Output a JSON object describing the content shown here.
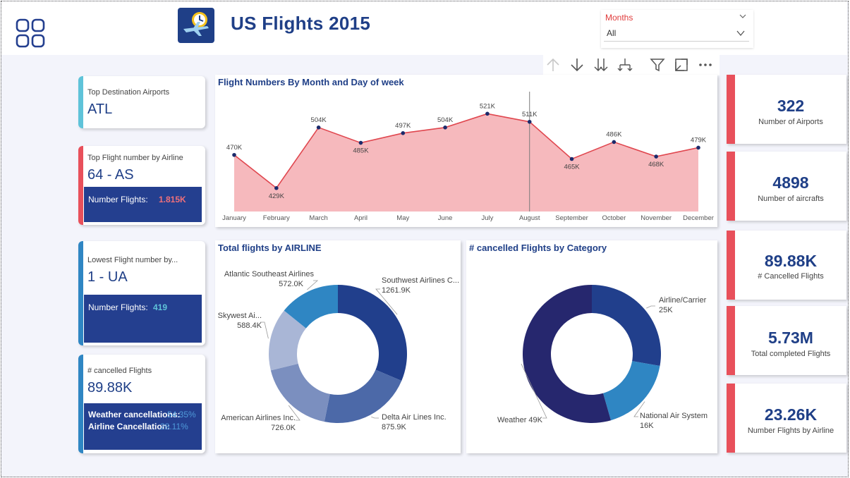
{
  "header": {
    "title": "US Flights 2015",
    "slicer": {
      "label": "Months",
      "value": "All"
    }
  },
  "toolbar": {
    "buttons": [
      "arrow-up-icon",
      "arrow-down-icon",
      "double-arrow-down-icon",
      "expand-hierarchy-icon",
      "filter-icon",
      "focus-mode-icon",
      "more-options-icon"
    ]
  },
  "cards": {
    "top_destination": {
      "label": "Top Destination Airports",
      "value": "ATL"
    },
    "top_airline": {
      "label": "Top Flight number by Airline",
      "value": "64 - AS",
      "band_label": "Number Flights:",
      "band_value": "1.815K"
    },
    "lowest_airline": {
      "label": "Lowest Flight number by...",
      "value": "1 - UA",
      "band_label": "Number Flights:",
      "band_value": "419"
    },
    "cancelled": {
      "label": "# cancelled Flights",
      "value": "89.88K",
      "weather_label": "Weather cancellations:",
      "weather_value": "54.35%",
      "airline_label": "Airline Cancellation:",
      "airline_value": "28.11%"
    }
  },
  "panels": {
    "monthly": {
      "title": "Flight Numbers By Month and Day of week"
    },
    "airline": {
      "title": "Total flights by AIRLINE"
    },
    "cancel_category": {
      "title": "# cancelled Flights by Category"
    }
  },
  "kpis": [
    {
      "value": "322",
      "label": "Number of Airports"
    },
    {
      "value": "4898",
      "label": "Number of aircrafts"
    },
    {
      "value": "89.88K",
      "label": "# Cancelled Flights"
    },
    {
      "value": "5.73M",
      "label": "Total completed Flights"
    },
    {
      "value": "23.26K",
      "label": "Number Flights by Airline"
    }
  ],
  "colors": {
    "accent_red": "#e8505b",
    "navy": "#1f3f87",
    "band_blue": "#243f8f",
    "area_fill": "#f6b9bd",
    "line_red": "#e0474f"
  },
  "chart_data": [
    {
      "type": "area",
      "title": "Flight Numbers By Month and Day of week",
      "categories": [
        "January",
        "February",
        "March",
        "April",
        "May",
        "June",
        "July",
        "August",
        "September",
        "October",
        "November",
        "December"
      ],
      "values": [
        470,
        429,
        504,
        485,
        497,
        504,
        521,
        511,
        465,
        486,
        468,
        479
      ],
      "data_labels": [
        "470K",
        "429K",
        "504K",
        "485K",
        "497K",
        "504K",
        "521K",
        "511K",
        "465K",
        "486K",
        "468K",
        "479K"
      ],
      "ylim": [
        400,
        530
      ],
      "grid": false,
      "highlight_category": "August"
    },
    {
      "type": "pie",
      "title": "Total flights by AIRLINE",
      "donut": true,
      "slices": [
        {
          "label": "Southwest Airlines C...",
          "value": 1261.9,
          "value_label": "1261.9K",
          "color": "#213f8c"
        },
        {
          "label": "Delta Air Lines Inc.",
          "value": 875.9,
          "value_label": "875.9K",
          "color": "#4c69a8"
        },
        {
          "label": "American Airlines Inc.",
          "value": 726.0,
          "value_label": "726.0K",
          "color": "#7b8fbf"
        },
        {
          "label": "Skywest Ai...",
          "value": 588.4,
          "value_label": "588.4K",
          "color": "#a9b6d6"
        },
        {
          "label": "Atlantic Southeast Airlines",
          "value": 572.0,
          "value_label": "572.0K",
          "color": "#2f86c3"
        }
      ]
    },
    {
      "type": "pie",
      "title": "# cancelled Flights by Category",
      "donut": true,
      "slices": [
        {
          "label": "Airline/Carrier",
          "value": 25,
          "value_label": "25K",
          "color": "#213f8c"
        },
        {
          "label": "National Air System",
          "value": 16,
          "value_label": "16K",
          "color": "#2f86c3"
        },
        {
          "label": "Weather",
          "value": 49,
          "value_label": "49K",
          "color": "#26276e"
        }
      ]
    }
  ]
}
